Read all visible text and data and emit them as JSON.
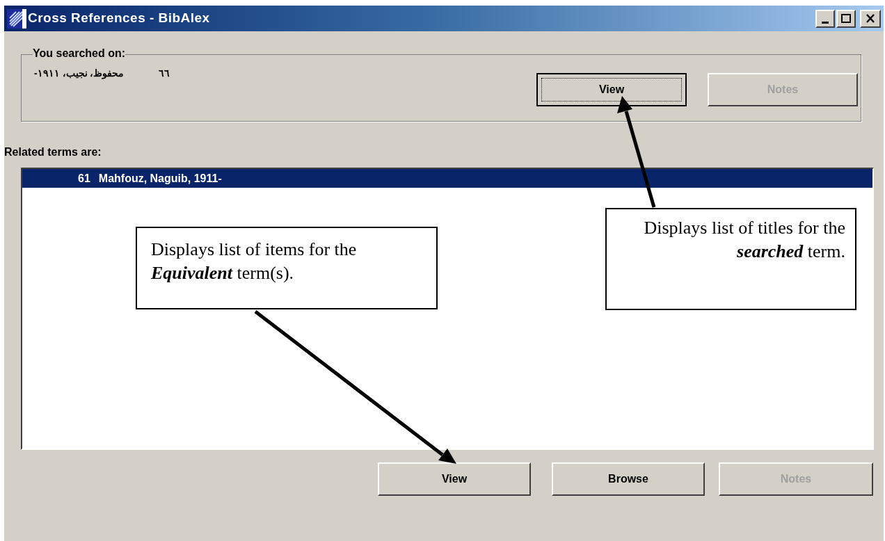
{
  "window": {
    "title": "Cross References - BibAlex"
  },
  "searched_group": {
    "label": "You searched on:",
    "number": "٦٦",
    "term": "محفوظ، نجيب، ١٩١١-"
  },
  "searched_buttons": [
    {
      "label": "View",
      "disabled": false,
      "focused": true
    },
    {
      "label": "Notes",
      "disabled": true,
      "focused": false
    }
  ],
  "related_label": "Related terms are:",
  "related_list": [
    {
      "number": "61",
      "term": "Mahfouz, Naguib, 1911-",
      "selected": true
    }
  ],
  "bottom_buttons": [
    {
      "label": "View",
      "disabled": false,
      "focused": false
    },
    {
      "label": "Browse",
      "disabled": false,
      "focused": false
    },
    {
      "label": "Notes",
      "disabled": true,
      "focused": false
    }
  ],
  "callouts": [
    {
      "text": "Displays list of items for the **Equivalent** term(s)."
    },
    {
      "text": "Displays list of titles for the **searched** term."
    }
  ]
}
